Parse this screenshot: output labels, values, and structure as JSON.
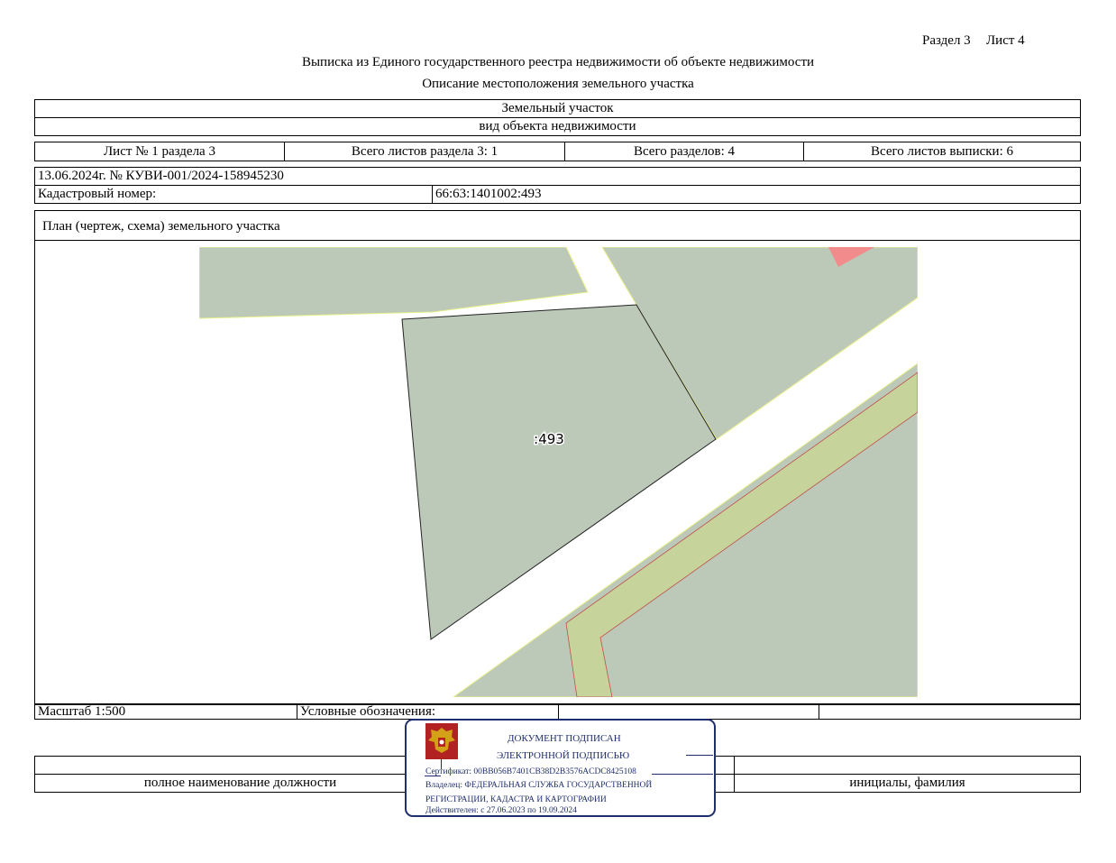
{
  "header": {
    "section": "Раздел 3",
    "sheet": "Лист 4",
    "title": "Выписка из Единого государственного реестра недвижимости об объекте недвижимости",
    "subtitle": "Описание местоположения земельного участка"
  },
  "object": {
    "type": "Земельный участок",
    "type_caption": "вид объекта недвижимости"
  },
  "sheets": {
    "sheet_of_section": "Лист № 1 раздела 3",
    "total_sheets_section": "Всего листов раздела 3: 1",
    "total_sections": "Всего разделов: 4",
    "total_sheets_extract": "Всего листов выписки: 6"
  },
  "record": {
    "date_number": "13.06.2024г. № КУВИ-001/2024-158945230",
    "cadastral_label": "Кадастровый номер:",
    "cadastral_value": "66:63:1401002:493"
  },
  "plan": {
    "title": "План (чертеж, схема) земельного участка",
    "parcel_label": ":493",
    "scale": "Масштаб 1:500",
    "legend_label": "Условные обозначения:"
  },
  "signature": {
    "position_caption": "полное наименование должности",
    "name_caption": "инициалы, фамилия"
  },
  "stamp": {
    "line1": "ДОКУМЕНТ ПОДПИСАН",
    "line2": "ЭЛЕКТРОННОЙ ПОДПИСЬЮ",
    "certificate": "Сертификат: 00BB056B7401CB38D2B3576ACDC8425108",
    "owner_line1": "Владелец: ФЕДЕРАЛЬНАЯ СЛУЖБА ГОСУДАРСТВЕННОЙ",
    "owner_line2": "РЕГИСТРАЦИИ, КАДАСТРА И КАРТОГРАФИИ",
    "validity": "Действителен: с 27.06.2023 по 19.09.2024",
    "emblem_icon": "double-headed-eagle-emblem-icon"
  },
  "colors": {
    "parcel_fill": "#bcc9b8",
    "road_strip_fill": "#c6d39a",
    "highlight_fill": "#f28c8c",
    "stamp_border": "#1f2e6e",
    "emblem_red": "#b22222"
  }
}
